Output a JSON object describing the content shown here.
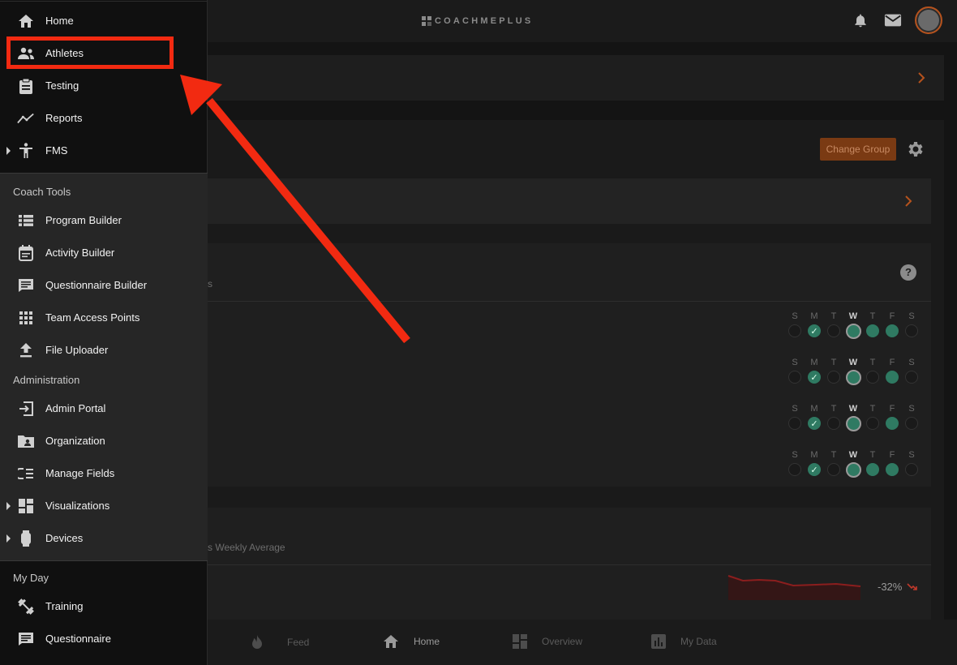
{
  "brand": {
    "name": "COACHMEPLUS"
  },
  "content": {
    "change_group": "Change Group",
    "help_glyph": "?",
    "frag_s": "s",
    "frag_weekly": "s Weekly Average",
    "trend_value": "-32%",
    "week_labels": [
      "S",
      "M",
      "T",
      "W",
      "T",
      "F",
      "S"
    ]
  },
  "sidebar": {
    "top": [
      {
        "label": "Home",
        "icon": "home-icon"
      },
      {
        "label": "Athletes",
        "icon": "people-icon"
      },
      {
        "label": "Testing",
        "icon": "clipboard-icon"
      },
      {
        "label": "Reports",
        "icon": "trend-line-icon"
      },
      {
        "label": "FMS",
        "icon": "person-standing-icon"
      }
    ],
    "coach_tools": {
      "title": "Coach Tools",
      "items": [
        {
          "label": "Program Builder",
          "icon": "list-view-icon"
        },
        {
          "label": "Activity Builder",
          "icon": "calendar-note-icon"
        },
        {
          "label": "Questionnaire Builder",
          "icon": "chat-box-icon"
        },
        {
          "label": "Team Access Points",
          "icon": "grid-dots-icon"
        },
        {
          "label": "File Uploader",
          "icon": "upload-icon"
        }
      ]
    },
    "administration": {
      "title": "Administration",
      "items": [
        {
          "label": "Admin Portal",
          "icon": "sign-in-icon"
        },
        {
          "label": "Organization",
          "icon": "folder-person-icon"
        },
        {
          "label": "Manage Fields",
          "icon": "fields-list-icon"
        },
        {
          "label": "Visualizations",
          "icon": "dashboard-icon"
        },
        {
          "label": "Devices",
          "icon": "watch-icon"
        }
      ]
    },
    "my_day": {
      "title": "My Day",
      "items": [
        {
          "label": "Training",
          "icon": "dumbbell-icon"
        },
        {
          "label": "Questionnaire",
          "icon": "chat-box-icon"
        }
      ]
    }
  },
  "bottom_nav": [
    {
      "label": "Feed",
      "icon": "flame-icon"
    },
    {
      "label": "Home",
      "icon": "home-icon"
    },
    {
      "label": "Overview",
      "icon": "dashboard-icon"
    },
    {
      "label": "My Data",
      "icon": "bar-chart-icon"
    }
  ],
  "colors": {
    "accent": "#b5521d",
    "highlight": "#f22a11",
    "success": "#2f7a62"
  }
}
